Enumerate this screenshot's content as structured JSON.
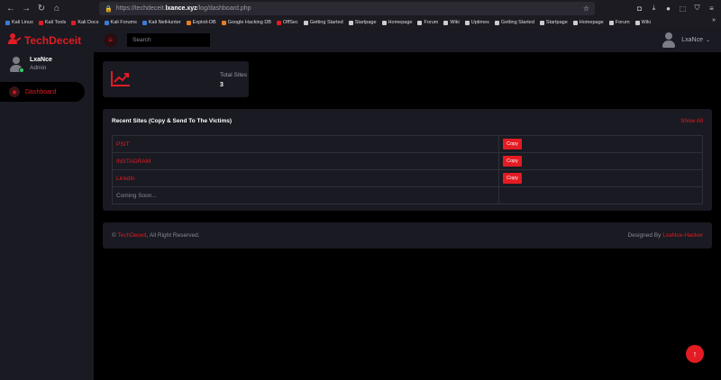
{
  "browser": {
    "url_prefix": "https://techdeceit.",
    "url_domain": "lxance.xyz",
    "url_path": "/log/dashboard.php",
    "bookmarks": [
      {
        "label": "Kali Linux",
        "color": "#3a7bd5"
      },
      {
        "label": "Kali Tools",
        "color": "#e31b23"
      },
      {
        "label": "Kali Docs",
        "color": "#e31b23"
      },
      {
        "label": "Kali Forums",
        "color": "#3a7bd5"
      },
      {
        "label": "Kali NetHunter",
        "color": "#3a7bd5"
      },
      {
        "label": "Exploit-DB",
        "color": "#e67e22"
      },
      {
        "label": "Google Hacking DB",
        "color": "#e67e22"
      },
      {
        "label": "OffSec",
        "color": "#e31b23"
      },
      {
        "label": "Getting Started",
        "color": "#cccccc"
      },
      {
        "label": "Startpage",
        "color": "#cccccc"
      },
      {
        "label": "Homepage",
        "color": "#cccccc"
      },
      {
        "label": "Forum",
        "color": "#cccccc"
      },
      {
        "label": "Wiki",
        "color": "#cccccc"
      },
      {
        "label": "Uptimes",
        "color": "#cccccc"
      },
      {
        "label": "Getting Started",
        "color": "#cccccc"
      },
      {
        "label": "Startpage",
        "color": "#cccccc"
      },
      {
        "label": "Homepage",
        "color": "#cccccc"
      },
      {
        "label": "Forum",
        "color": "#cccccc"
      },
      {
        "label": "Wiki",
        "color": "#cccccc"
      }
    ]
  },
  "brand": {
    "name": "TechDeceit",
    "color": "#e31b23"
  },
  "user": {
    "name": "LxaNce",
    "role": "Admin",
    "top_name": "LxaNce"
  },
  "sidebar": {
    "items": [
      {
        "label": "Dashboard"
      }
    ]
  },
  "search": {
    "placeholder": "Search"
  },
  "stats": {
    "label": "Total Sites",
    "value": "3"
  },
  "sites": {
    "title": "Recent Sites (Copy & Send To The Victims)",
    "show_all": "Show All",
    "copy_label": "Copy",
    "rows": [
      {
        "name": "PSIT",
        "copy": true
      },
      {
        "name": "INSTAGRAM",
        "copy": true
      },
      {
        "name": "Linkdin",
        "copy": true
      },
      {
        "name": "Coming Soon...",
        "copy": false
      }
    ]
  },
  "footer": {
    "left_prefix": "© ",
    "left_brand": "TechDeceit",
    "left_suffix": ", All Right Reserved.",
    "right_prefix": "Designed By ",
    "right_author": "LxaNce-Hacker"
  }
}
